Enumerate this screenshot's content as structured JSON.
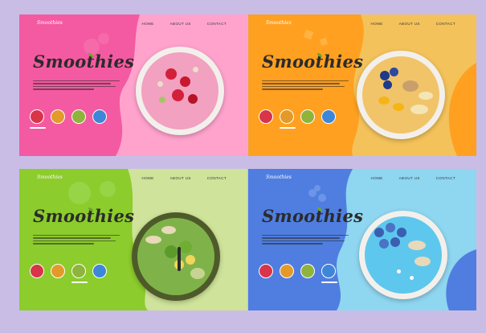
{
  "panels": [
    {
      "theme": "pink",
      "brand": "Smoothies",
      "nav": [
        "HOME",
        "ABOUT US",
        "CONTACT"
      ],
      "title": "Smoothies",
      "bg": "#ffa3cd",
      "blob": "#f45aa1",
      "bowl": "#f2a1c0"
    },
    {
      "theme": "orange",
      "brand": "Smoothies",
      "nav": [
        "HOME",
        "ABOUT US",
        "CONTACT"
      ],
      "title": "Smoothies",
      "bg": "#f4c25a",
      "blob": "#ffa020",
      "bowl": "#f1c46a"
    },
    {
      "theme": "green",
      "brand": "Smoothies",
      "nav": [
        "HOME",
        "ABOUT US",
        "CONTACT"
      ],
      "title": "Smoothies",
      "bg": "#cfe39a",
      "blob": "#8ccc2c",
      "bowl": "#7fb34a"
    },
    {
      "theme": "blue",
      "brand": "Smoothies",
      "nav": [
        "HOME",
        "ABOUT US",
        "CONTACT"
      ],
      "title": "Smoothies",
      "bg": "#8fd6f0",
      "blob": "#4f7ee0",
      "bowl": "#5ec7ee"
    }
  ],
  "thumb_colors": [
    "#d8344a",
    "#e39a2a",
    "#8fb43b",
    "#3d86d8"
  ]
}
